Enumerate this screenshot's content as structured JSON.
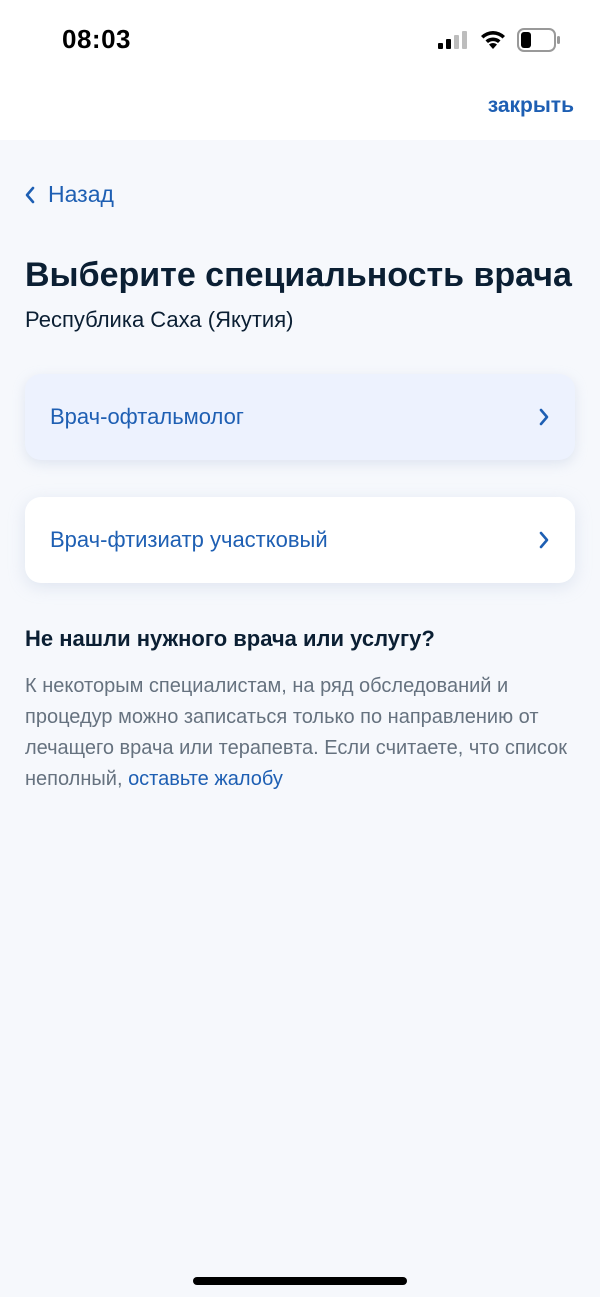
{
  "status_bar": {
    "time": "08:03",
    "icons": [
      "signal-icon",
      "wifi-icon",
      "battery-icon"
    ]
  },
  "header": {
    "close_label": "закрыть"
  },
  "nav": {
    "back_label": "Назад",
    "back_icon": "chevron-left-icon"
  },
  "page": {
    "title": "Выберите специальность врача",
    "region": "Республика Саха (Якутия)"
  },
  "specialties": [
    {
      "label": "Врач-офтальмолог",
      "icon": "chevron-right-icon"
    },
    {
      "label": "Врач-фтизиатр участковый",
      "icon": "chevron-right-icon"
    }
  ],
  "help": {
    "heading": "Не нашли нужного врача или услугу?",
    "text": "К некоторым специалистам, на ряд обследований и процедур можно записаться только по направлению от лечащего врача или терапевта. Если считаете, что список неполный,",
    "link_label": "оставьте жалобу"
  },
  "colors": {
    "accent": "#1e5fb3",
    "title": "#0b1f33",
    "muted_text": "#66727f",
    "background": "#f6f8fc",
    "selected_card": "#edf2fe"
  }
}
